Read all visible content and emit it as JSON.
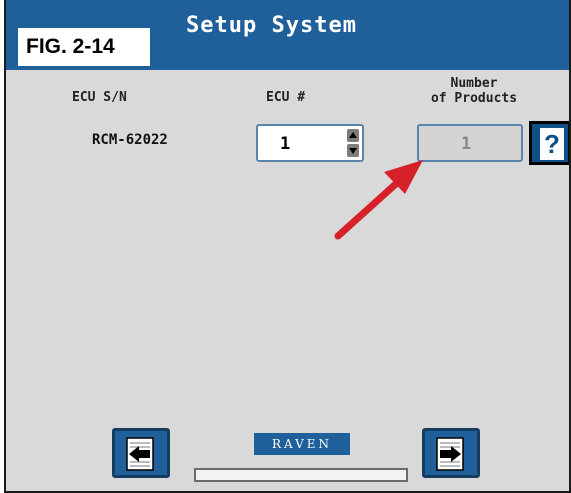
{
  "figure_label": "FIG. 2-14",
  "screen": {
    "title": "Setup System"
  },
  "columns": {
    "ecu_sn": "ECU S/N",
    "ecu_num": "ECU #",
    "products_line1": "Number",
    "products_line2": "of Products"
  },
  "row": {
    "serial": "RCM-62022",
    "ecu_num": "1",
    "products": "1"
  },
  "help_button": {
    "label": "?"
  },
  "logo": "RAVEN",
  "icons": {
    "spinner_up": "triangle-up-icon",
    "spinner_down": "triangle-down-icon",
    "prev": "back-page-icon",
    "next": "forward-page-icon"
  },
  "colors": {
    "title_bar": "#1f5f9a",
    "panel": "#d9d9d9",
    "annotation_arrow": "#d6202a"
  }
}
